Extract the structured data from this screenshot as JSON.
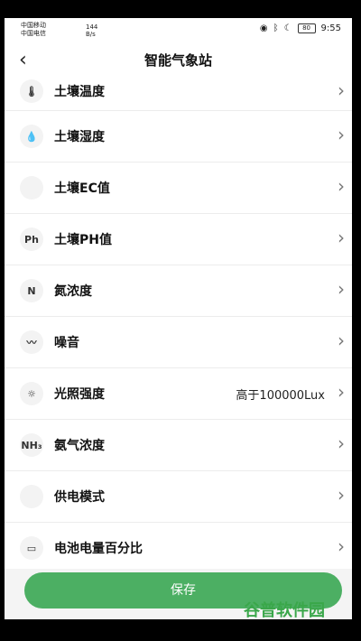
{
  "status_bar": {
    "carrier1": "中国移动",
    "carrier2": "中国电信",
    "speed_value": "144",
    "speed_unit": "B/s",
    "battery": "80",
    "time": "9:55"
  },
  "header": {
    "title": "智能气象站",
    "back_icon": "chevron-left-icon"
  },
  "list": [
    {
      "label": "土壤温度",
      "icon": "thermometer-icon",
      "value": ""
    },
    {
      "label": "土壤湿度",
      "icon": "water-drop-icon",
      "value": ""
    },
    {
      "label": "土壤EC值",
      "icon": "ec-icon",
      "value": ""
    },
    {
      "label": "土壤PH值",
      "icon": "ph-icon",
      "icon_text": "Ph",
      "value": ""
    },
    {
      "label": "氮浓度",
      "icon": "nitrogen-icon",
      "icon_text": "N",
      "value": ""
    },
    {
      "label": "噪音",
      "icon": "sound-wave-icon",
      "value": ""
    },
    {
      "label": "光照强度",
      "icon": "sun-icon",
      "value": "高于100000Lux"
    },
    {
      "label": "氨气浓度",
      "icon": "nh3-cloud-icon",
      "icon_text": "NH₃",
      "value": ""
    },
    {
      "label": "供电模式",
      "icon": "power-icon",
      "value": ""
    },
    {
      "label": "电池电量百分比",
      "icon": "battery-icon",
      "value": ""
    }
  ],
  "footer": {
    "save_label": "保存"
  },
  "watermark": "谷普软件园"
}
